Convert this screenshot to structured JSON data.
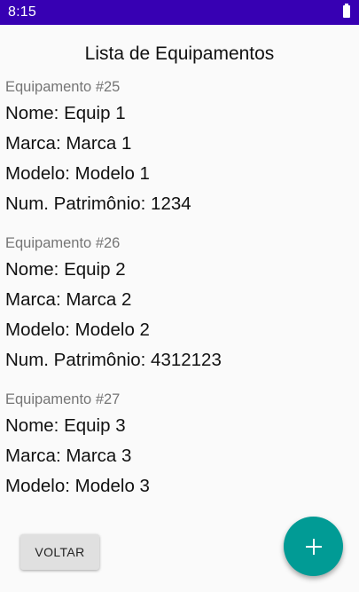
{
  "status_bar": {
    "time": "8:15",
    "battery_icon": "battery-full-icon",
    "color": "#3700b3"
  },
  "page": {
    "title": "Lista de Equipamentos"
  },
  "equipment": [
    {
      "header": "Equipamento #25",
      "nome": "Nome: Equip 1",
      "marca": "Marca: Marca 1",
      "modelo": "Modelo: Modelo 1",
      "patrimonio": "Num. Patrimônio: 1234"
    },
    {
      "header": "Equipamento #26",
      "nome": "Nome: Equip 2",
      "marca": "Marca: Marca 2",
      "modelo": "Modelo: Modelo 2",
      "patrimonio": "Num. Patrimônio: 4312123"
    },
    {
      "header": "Equipamento #27",
      "nome": "Nome: Equip 3",
      "marca": "Marca: Marca 3",
      "modelo": "Modelo: Modelo 3"
    }
  ],
  "actions": {
    "back_label": "VOLTAR",
    "fab_icon": "plus-icon",
    "fab_color": "#019b95"
  }
}
